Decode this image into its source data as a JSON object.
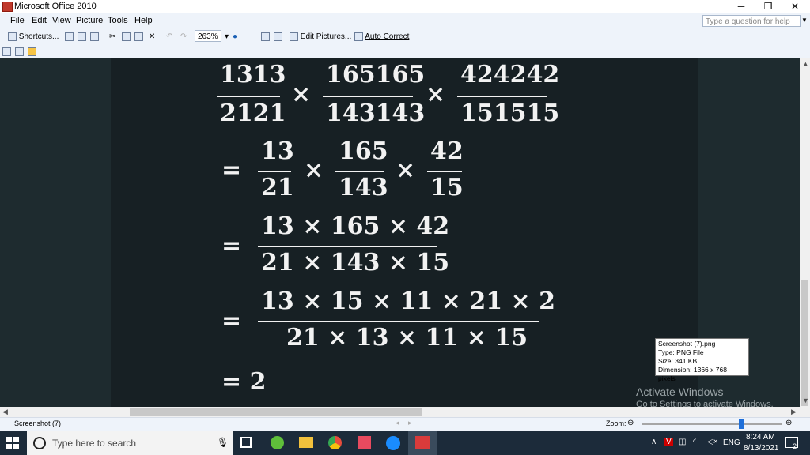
{
  "window": {
    "title": "Microsoft Office 2010",
    "minimize": "─",
    "restore": "❐",
    "close": "✕"
  },
  "menu": {
    "items": [
      "File",
      "Edit",
      "View",
      "Picture",
      "Tools",
      "Help"
    ],
    "help_placeholder": "Type a question for help"
  },
  "toolbar": {
    "shortcuts": "Shortcuts...",
    "zoom": "263%",
    "edit_pictures": "Edit Pictures...",
    "auto_correct": "Auto Correct"
  },
  "math": {
    "line1": {
      "n1": "1313",
      "d1": "2121",
      "n2": "165165",
      "d2": "143143",
      "n3": "424242",
      "d3": "151515",
      "op": "×"
    },
    "line2": {
      "eq": "=",
      "n1": "13",
      "d1": "21",
      "n2": "165",
      "d2": "143",
      "n3": "42",
      "d3": "15",
      "op": "×"
    },
    "line3": {
      "eq": "=",
      "num": "13 × 165 × 42",
      "den": "21 × 143 × 15"
    },
    "line4": {
      "eq": "=",
      "num": "13 × 15 × 11 × 21 × 2",
      "den": "21 × 13 × 11 × 15"
    },
    "line5": {
      "eq": "= 2"
    }
  },
  "tooltip": {
    "name": "Screenshot (7).png",
    "type": "Type: PNG File",
    "size": "Size: 341 KB",
    "dimension": "Dimension: 1366 x 768 pixels"
  },
  "watermark": {
    "title": "Activate Windows",
    "subtitle": "Go to Settings to activate Windows."
  },
  "status": {
    "filename": "Screenshot (7)",
    "zoom_label": "Zoom:"
  },
  "taskbar": {
    "search_placeholder": "Type here to search",
    "lang": "ENG",
    "time": "8:24 AM",
    "date": "8/13/2021",
    "notifications": "2"
  }
}
